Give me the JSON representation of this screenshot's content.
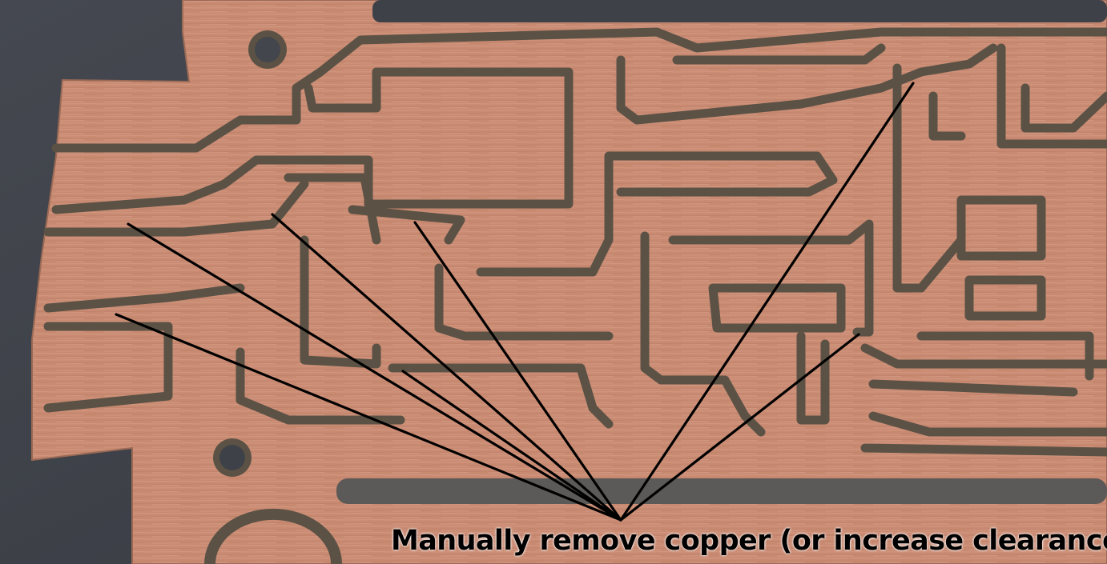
{
  "annotation": {
    "label": "Manually remove copper (or increase clearance)",
    "pointer_count": 8
  },
  "colors": {
    "background": "#3e4148",
    "copper": "#c98a72",
    "isolation_groove": "#5b5245",
    "pointer_line": "#000000",
    "label_text": "#000000"
  }
}
